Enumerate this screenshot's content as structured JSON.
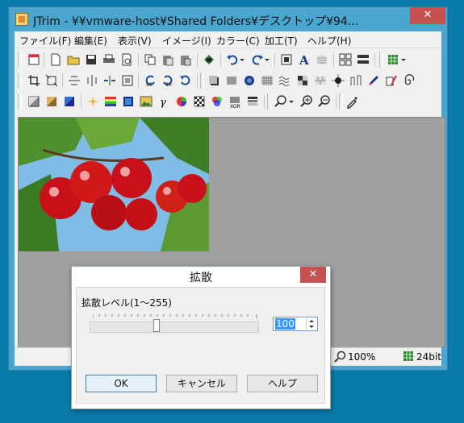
{
  "window": {
    "title": "JTrim - ¥¥vmware-host¥Shared Folders¥デスクトップ¥94...",
    "close_label": "✕"
  },
  "menu": [
    "ファイル(F)",
    "編集(E)",
    "表示(V)",
    "イメージ(I)",
    "カラー(C)",
    "加工(T)",
    "ヘルプ(H)"
  ],
  "toolbar1": [
    "new-doc-window-icon",
    "new-file-icon",
    "open-folder-icon",
    "save-icon",
    "print-icon",
    "print-preview-icon",
    "copy-icon",
    "paste-icon",
    "paste-new-icon",
    "capture-icon",
    "undo-icon",
    "redo-icon",
    "fit-icon",
    "text-icon",
    "stripe-icon",
    "grid-icon",
    "list-icon",
    "palette-icon"
  ],
  "toolbar2": [
    "crop-icon",
    "resize-icon",
    "flip-horizontal-icon",
    "flip-vertical-icon",
    "mirror-icon",
    "frame-icon",
    "rotate-left-icon",
    "rotate-90-icon",
    "rotate-right-icon",
    "shadow-icon",
    "shade-icon",
    "blur-icon",
    "mosaic-icon",
    "wave-icon",
    "emboss-icon",
    "brick-icon",
    "burst-icon",
    "edge-icon",
    "pen-icon",
    "marker-icon",
    "swirl-icon"
  ],
  "toolbar3": [
    "gray-icon",
    "sepia-icon",
    "blue-tone-icon",
    "sparkle-icon",
    "rainbow-icon",
    "picture-icon",
    "gamma-icon",
    "hue-icon",
    "checker-icon",
    "rgb-icon",
    "noise-icon",
    "gradient-icon",
    "zoom-menu-icon",
    "zoom-in-icon",
    "zoom-out-icon",
    "eyedropper-icon"
  ],
  "status": {
    "zoom": "100%",
    "depth": "24bit"
  },
  "dialog": {
    "title": "拡散",
    "close_label": "✕",
    "label": "拡散レベル(1～255)",
    "value": "100",
    "slider_fraction": 0.39,
    "ok": "OK",
    "cancel": "キャンセル",
    "help": "ヘルプ"
  },
  "colors": {
    "titlebar": "#4aa6cf",
    "desktop": "#0a7aa8",
    "close": "#c75050",
    "canvas_bg": "#a0a0a0"
  }
}
